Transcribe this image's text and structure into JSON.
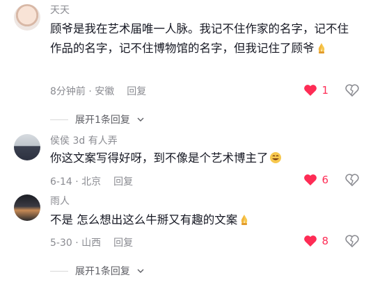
{
  "comments": [
    {
      "username": "天天",
      "text_parts": [
        "顾爷是我在艺术届唯一人脉。我记不住作家的名字，记不住作品的名字，记不住博物馆的名字，但我记住了顾爷"
      ],
      "emoji": "pray-hands-emoji",
      "time_location": "8分钟前 · 安徽",
      "reply_label": "回复",
      "likes": "1",
      "liked": true,
      "expand_label": "展开1条回复"
    },
    {
      "username": "侯侯 3d 有人弄",
      "text_parts": [
        "你这文案写得好呀，到不像是个艺术博主了"
      ],
      "emoji": "grin-face-emoji",
      "time_location": "6-14 · 北京",
      "reply_label": "回复",
      "likes": "6",
      "liked": true
    },
    {
      "username": "雨人",
      "text_parts": [
        "不是 怎么想出这么牛掰又有趣的文案"
      ],
      "emoji": "pray-hands-emoji",
      "time_location": "5-30 · 山西",
      "reply_label": "回复",
      "likes": "8",
      "liked": true,
      "expand_label": "展开1条回复"
    }
  ],
  "colors": {
    "like": "#fe2c55",
    "meta": "#8a8b91",
    "text": "#161823"
  }
}
